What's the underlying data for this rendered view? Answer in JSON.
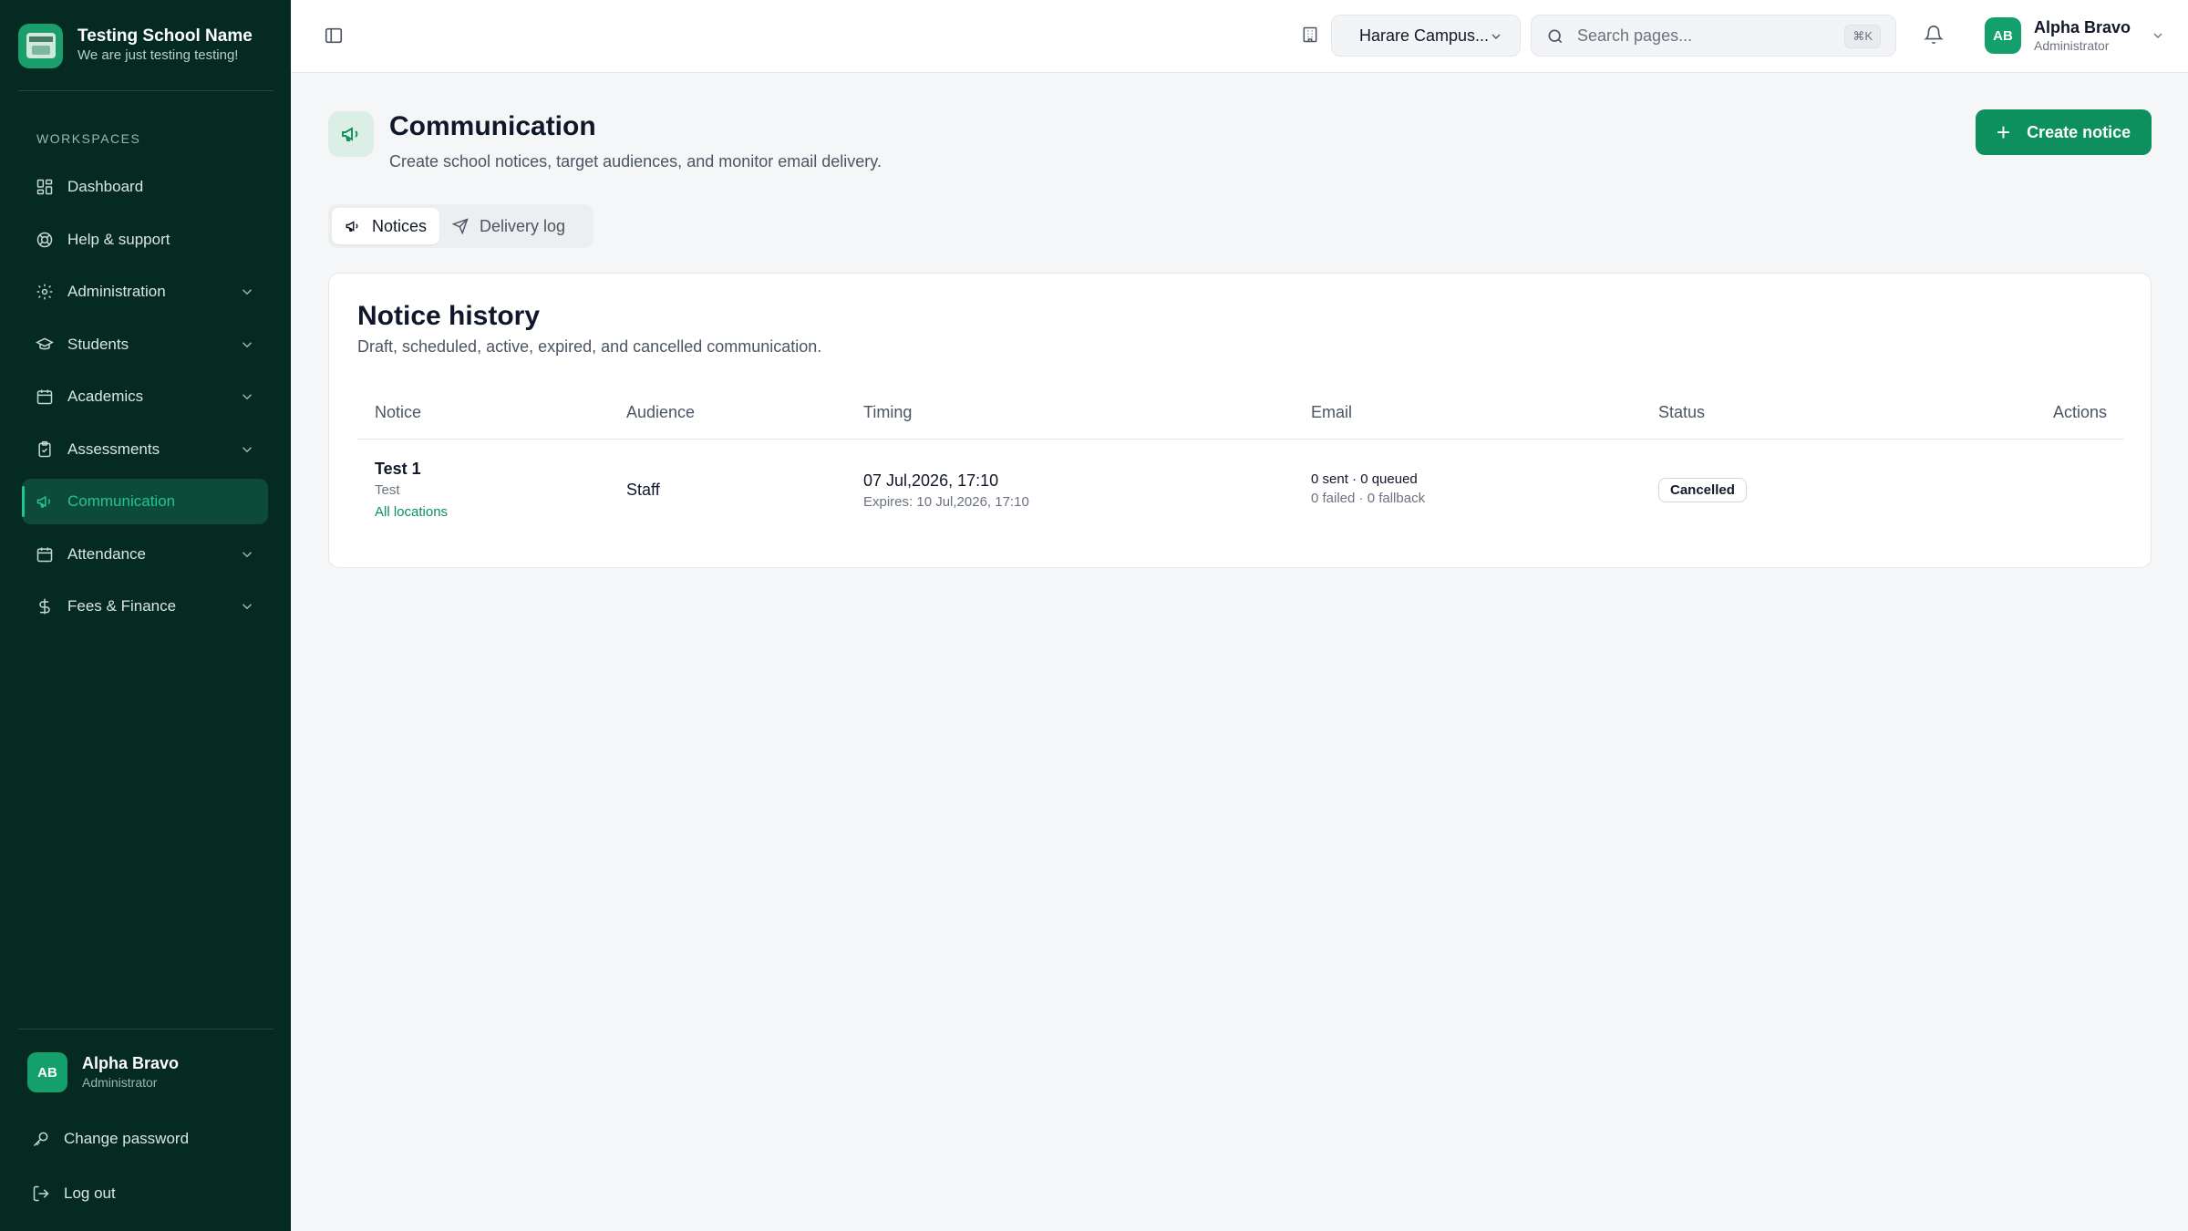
{
  "brand": {
    "name": "Testing School Name",
    "tagline": "We are just testing testing!"
  },
  "sidebar": {
    "section_label": "WORKSPACES",
    "items": [
      {
        "label": "Dashboard",
        "icon": "dashboard-icon",
        "expandable": false
      },
      {
        "label": "Help & support",
        "icon": "lifebuoy-icon",
        "expandable": false
      },
      {
        "label": "Administration",
        "icon": "gear-icon",
        "expandable": true
      },
      {
        "label": "Students",
        "icon": "graduation-cap-icon",
        "expandable": true
      },
      {
        "label": "Academics",
        "icon": "calendar-icon",
        "expandable": true
      },
      {
        "label": "Assessments",
        "icon": "clipboard-check-icon",
        "expandable": true
      },
      {
        "label": "Communication",
        "icon": "megaphone-icon",
        "expandable": false,
        "active": true
      },
      {
        "label": "Attendance",
        "icon": "calendar-icon",
        "expandable": true
      },
      {
        "label": "Fees & Finance",
        "icon": "dollar-icon",
        "expandable": true
      }
    ],
    "user": {
      "initials": "AB",
      "name": "Alpha Bravo",
      "role": "Administrator"
    },
    "change_password": "Change password",
    "logout": "Log out"
  },
  "topbar": {
    "campus": "Harare Campus...",
    "search_placeholder": "Search pages...",
    "search_shortcut": "⌘K",
    "user": {
      "initials": "AB",
      "name": "Alpha Bravo",
      "role": "Administrator"
    }
  },
  "page": {
    "title": "Communication",
    "subtitle": "Create school notices, target audiences, and monitor email delivery.",
    "create_button": "Create notice"
  },
  "tabs": [
    {
      "label": "Notices",
      "active": true
    },
    {
      "label": "Delivery log",
      "active": false
    }
  ],
  "card": {
    "title": "Notice history",
    "subtitle": "Draft, scheduled, active, expired, and cancelled communication.",
    "columns": [
      "Notice",
      "Audience",
      "Timing",
      "Email",
      "Status",
      "Actions"
    ],
    "rows": [
      {
        "notice_title": "Test 1",
        "notice_desc": "Test",
        "location": "All locations",
        "audience": "Staff",
        "timing": "07 Jul,2026, 17:10",
        "expires": "Expires: 10 Jul,2026, 17:10",
        "email_line1": "0 sent · 0 queued",
        "email_line2": "0 failed · 0 fallback",
        "status": "Cancelled"
      }
    ]
  },
  "colors": {
    "sidebar_bg": "#052a22",
    "accent": "#0e8f5e",
    "active_text": "#22c58a"
  }
}
